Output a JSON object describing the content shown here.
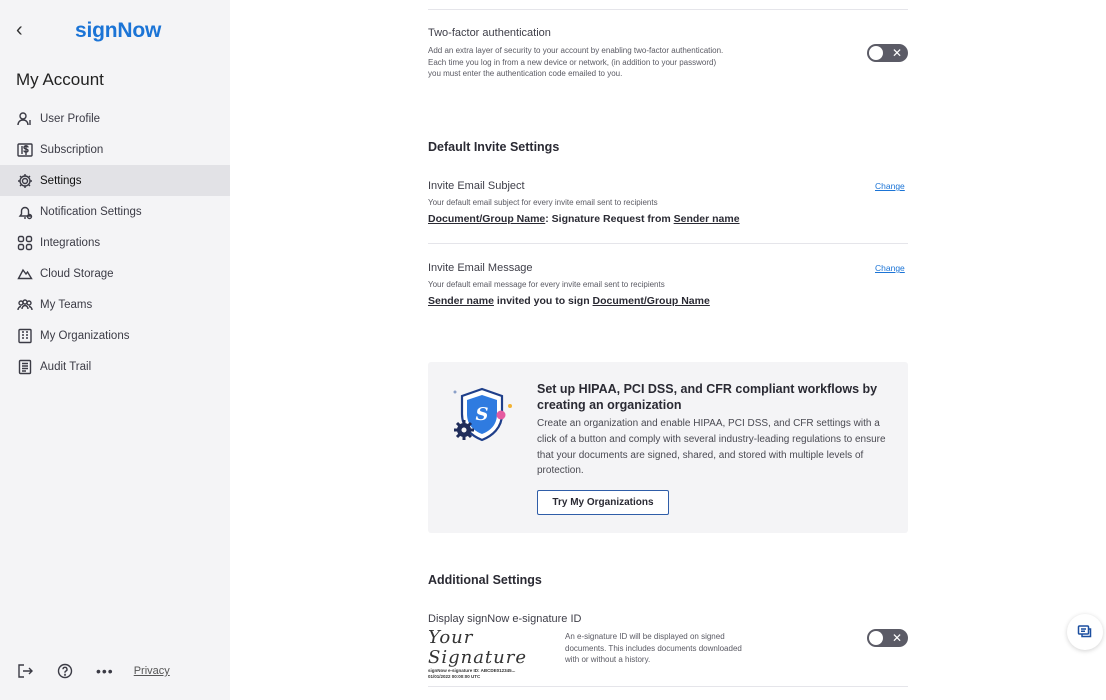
{
  "sidebar": {
    "back_glyph": "‹",
    "logo": "signNow",
    "title": "My Account",
    "items": [
      {
        "label": "User Profile",
        "icon": "user-icon"
      },
      {
        "label": "Subscription",
        "icon": "dollar-card-icon"
      },
      {
        "label": "Settings",
        "icon": "gear-icon",
        "active": true
      },
      {
        "label": "Notification Settings",
        "icon": "bell-icon"
      },
      {
        "label": "Integrations",
        "icon": "grid-icon"
      },
      {
        "label": "Cloud Storage",
        "icon": "cloud-icon"
      },
      {
        "label": "My Teams",
        "icon": "team-icon"
      },
      {
        "label": "My Organizations",
        "icon": "organization-icon"
      },
      {
        "label": "Audit Trail",
        "icon": "audit-icon"
      }
    ],
    "footer": {
      "dots": "•••",
      "privacy": "Privacy"
    }
  },
  "two_factor": {
    "label": "Two-factor authentication",
    "desc_line1": "Add an extra layer of security to your account by enabling two-factor authentication.",
    "desc_line2": "Each time you log in from a new device or network, (in addition to your password)",
    "desc_line3": "you must enter the authentication code emailed to you.",
    "enabled": false,
    "toggle_glyph": "✕"
  },
  "invite": {
    "heading": "Default Invite Settings",
    "subject": {
      "label": "Invite Email Subject",
      "desc": "Your default email subject for every invite email sent to recipients",
      "var1": "Document/Group Name",
      "mid": ": Signature Request from ",
      "var2": "Sender name",
      "change": "Change"
    },
    "message": {
      "label": "Invite Email Message",
      "desc": "Your default email message for every invite email sent to recipients",
      "var1": "Sender name",
      "mid": " invited you to sign ",
      "var2": "Document/Group Name",
      "change": "Change"
    }
  },
  "promo": {
    "title": "Set up HIPAA, PCI DSS, and CFR compliant workflows by creating an organization",
    "desc": "Create an organization and enable HIPAA, PCI DSS, and CFR settings with a click of a button and comply with several industry-leading regulations to ensure that your documents are signed, shared, and stored with multiple levels of protection.",
    "button": "Try My Organizations",
    "badge_letter": "S"
  },
  "additional": {
    "heading": "Additional Settings",
    "esig": {
      "label": "Display signNow e-signature ID",
      "sample_script": "Your Signature",
      "sample_meta1": "signNow e-signature ID: ABCDE012345...",
      "sample_meta2": "01/01/2022 00:00:00 UTC",
      "desc_line1": "An e-signature ID will be displayed on signed",
      "desc_line2": "documents. This includes documents downloaded",
      "desc_line3": "with or without a history.",
      "enabled": false,
      "toggle_glyph": "✕"
    }
  },
  "colors": {
    "brand": "#1b74d6",
    "toggle_off": "#5b5b66",
    "sidebar_bg": "#f4f4f6",
    "active_item": "#e2e2e6"
  }
}
